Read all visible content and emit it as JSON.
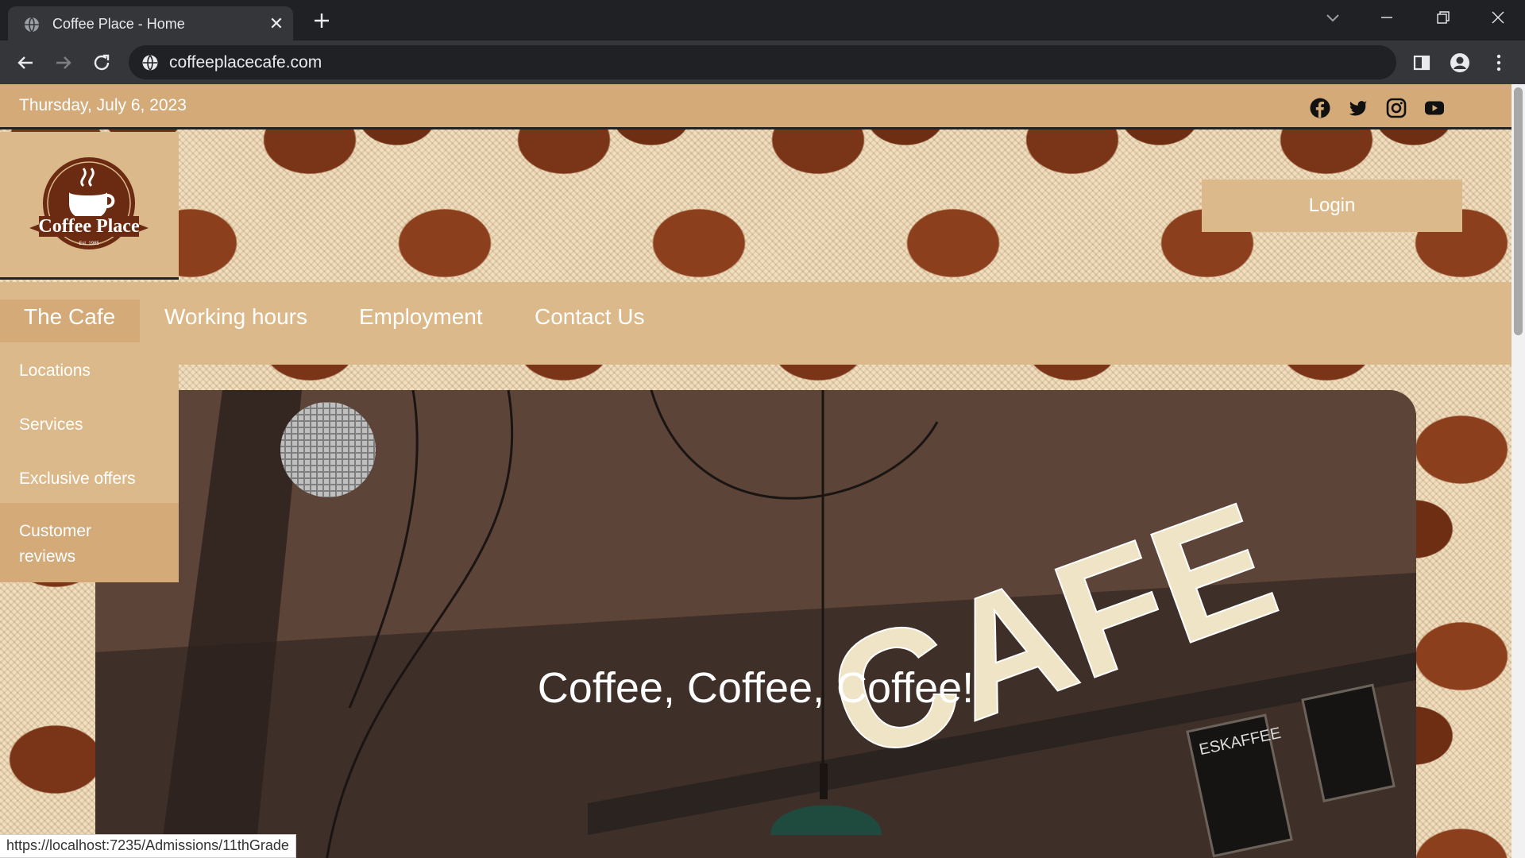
{
  "browser": {
    "tab_title": "Coffee Place - Home",
    "url": "coffeeplacecafe.com",
    "status_url": "https://localhost:7235/Admissions/11thGrade"
  },
  "site": {
    "date": "Thursday, July 6, 2023",
    "logo_text": "Coffee Place",
    "logo_sub": "Est. 1985",
    "login_label": "Login",
    "nav": [
      "The Cafe",
      "Working hours",
      "Employment",
      "Contact Us"
    ],
    "dropdown": [
      "Locations",
      "Services",
      "Exclusive offers",
      "Customer reviews"
    ],
    "hero_title": "Coffee, Coffee, Coffee!",
    "hero_sign": "CAFE",
    "menu_board_title": "ESKAFFEE",
    "social": [
      "facebook-icon",
      "twitter-icon",
      "instagram-icon",
      "youtube-icon"
    ]
  },
  "colors": {
    "header_tan": "#d3aa78",
    "nav_tan": "#dcb98a",
    "brand_brown": "#6b2a12"
  }
}
